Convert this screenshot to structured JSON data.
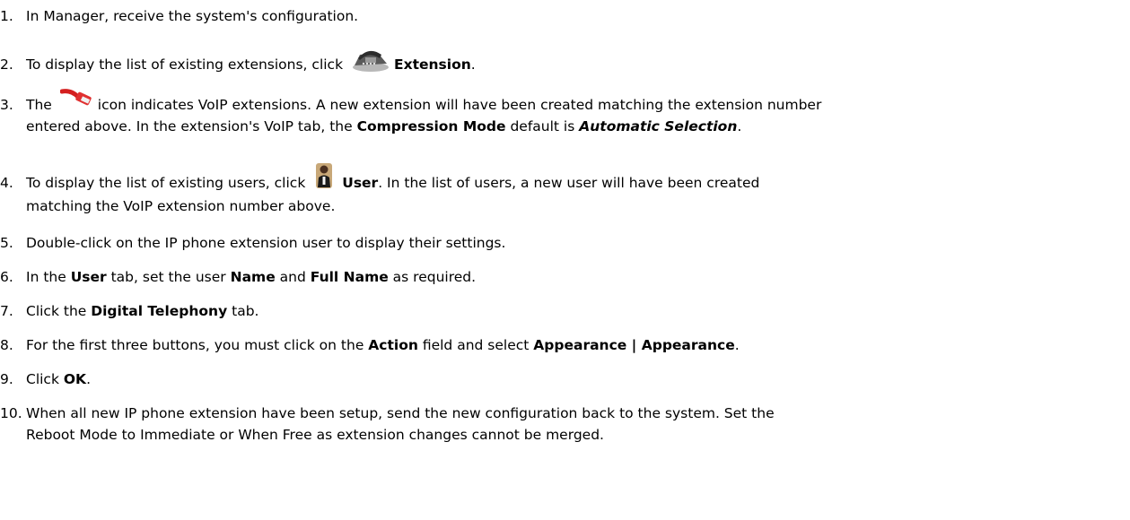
{
  "steps": [
    {
      "num": "1.",
      "text": "In Manager, receive the system's configuration."
    },
    {
      "num": "2.",
      "a": "To display the list of existing extensions, click",
      "b": "Extension",
      "c": "."
    },
    {
      "num": "3.",
      "a": "The",
      "b": "icon indicates VoIP extensions. A new extension will have been created matching the extension number",
      "c": "entered above. In the extension's VoIP tab, the",
      "d": "Compression Mode",
      "e": "default is",
      "f": "Automatic Selection",
      "g": "."
    },
    {
      "num": "4.",
      "a": "To display the list of existing users, click",
      "b": "User",
      "c": ". In the list of users, a new user will have been created",
      "d": "matching the VoIP extension number above."
    },
    {
      "num": "5.",
      "text": "Double-click on the IP phone extension user to display their settings."
    },
    {
      "num": "6.",
      "a": "In the",
      "b": "User",
      "c": "tab, set the user",
      "d": "Name",
      "e": "and",
      "f": "Full Name",
      "g": "as required."
    },
    {
      "num": "7.",
      "a": "Click the",
      "b": "Digital Telephony",
      "c": "tab."
    },
    {
      "num": "8.",
      "a": "For the first three buttons, you must click on the",
      "b": "Action",
      "c": "field and select",
      "d": "Appearance | Appearance",
      "e": "."
    },
    {
      "num": "9.",
      "a": "Click",
      "b": "OK",
      "c": "."
    },
    {
      "num": "10.",
      "a": "When all new IP phone extension have been setup, send the new configuration back to the system. Set the",
      "b": "Reboot Mode to Immediate or When Free as extension changes cannot be merged."
    }
  ],
  "icons": {
    "extension": "phone-icon",
    "voip": "network-cable-icon",
    "user": "user-icon"
  }
}
